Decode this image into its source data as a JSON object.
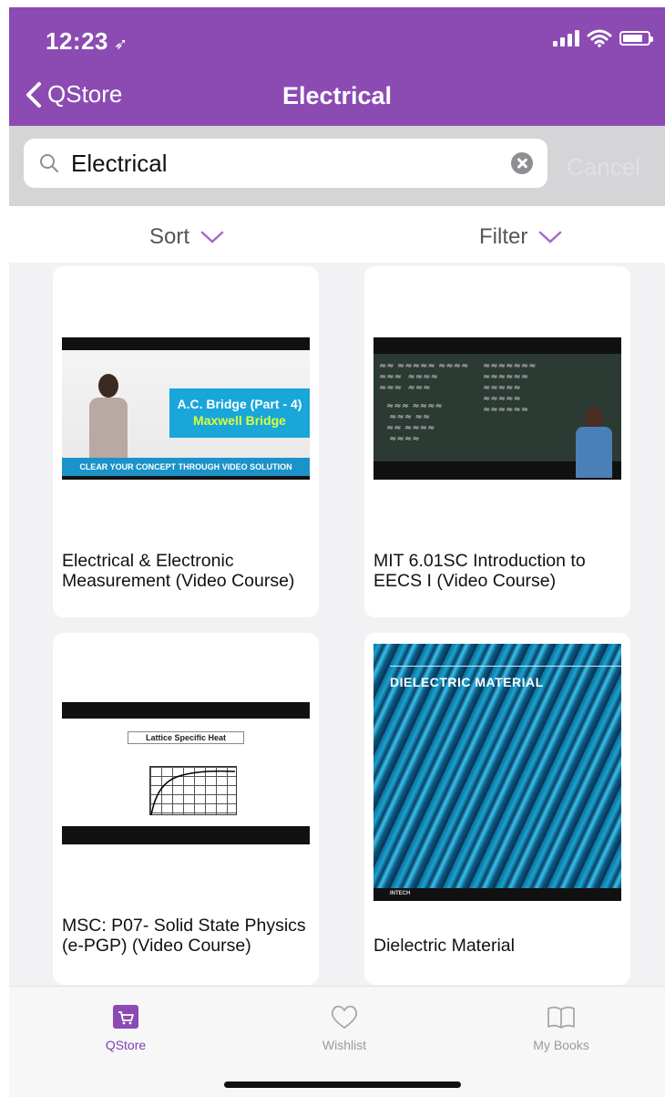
{
  "status_bar": {
    "time": "12:23",
    "location_glyph": "➶"
  },
  "nav": {
    "back_label": "QStore",
    "title": "Electrical"
  },
  "search": {
    "value": "Electrical",
    "placeholder": "",
    "cancel_label": "Cancel"
  },
  "toolbar": {
    "sort_label": "Sort",
    "filter_label": "Filter"
  },
  "items": [
    {
      "title": "Electrical & Electronic Measurement (Video Course)",
      "thumb": {
        "line1": "A.C. Bridge (Part - 4)",
        "line2": "Maxwell Bridge",
        "banner": "CLEAR YOUR CONCEPT THROUGH VIDEO SOLUTION"
      }
    },
    {
      "title": "MIT 6.01SC Introduction to EECS I (Video Course)"
    },
    {
      "title": "MSC: P07- Solid State Physics (e-PGP) (Video Course)",
      "thumb": {
        "slide_title": "Lattice Specific Heat"
      }
    },
    {
      "title": "Dielectric Material",
      "thumb": {
        "cover_title": "DIELECTRIC MATERIAL",
        "publisher": "INTECH"
      }
    }
  ],
  "tabs": [
    {
      "label": "QStore",
      "icon": "store-icon",
      "active": true
    },
    {
      "label": "Wishlist",
      "icon": "heart-icon",
      "active": false
    },
    {
      "label": "My Books",
      "icon": "book-icon",
      "active": false
    }
  ],
  "colors": {
    "accent": "#8b4bb3",
    "active_tab": "#7e3fb0",
    "inactive_tab": "#9a9a9e"
  }
}
